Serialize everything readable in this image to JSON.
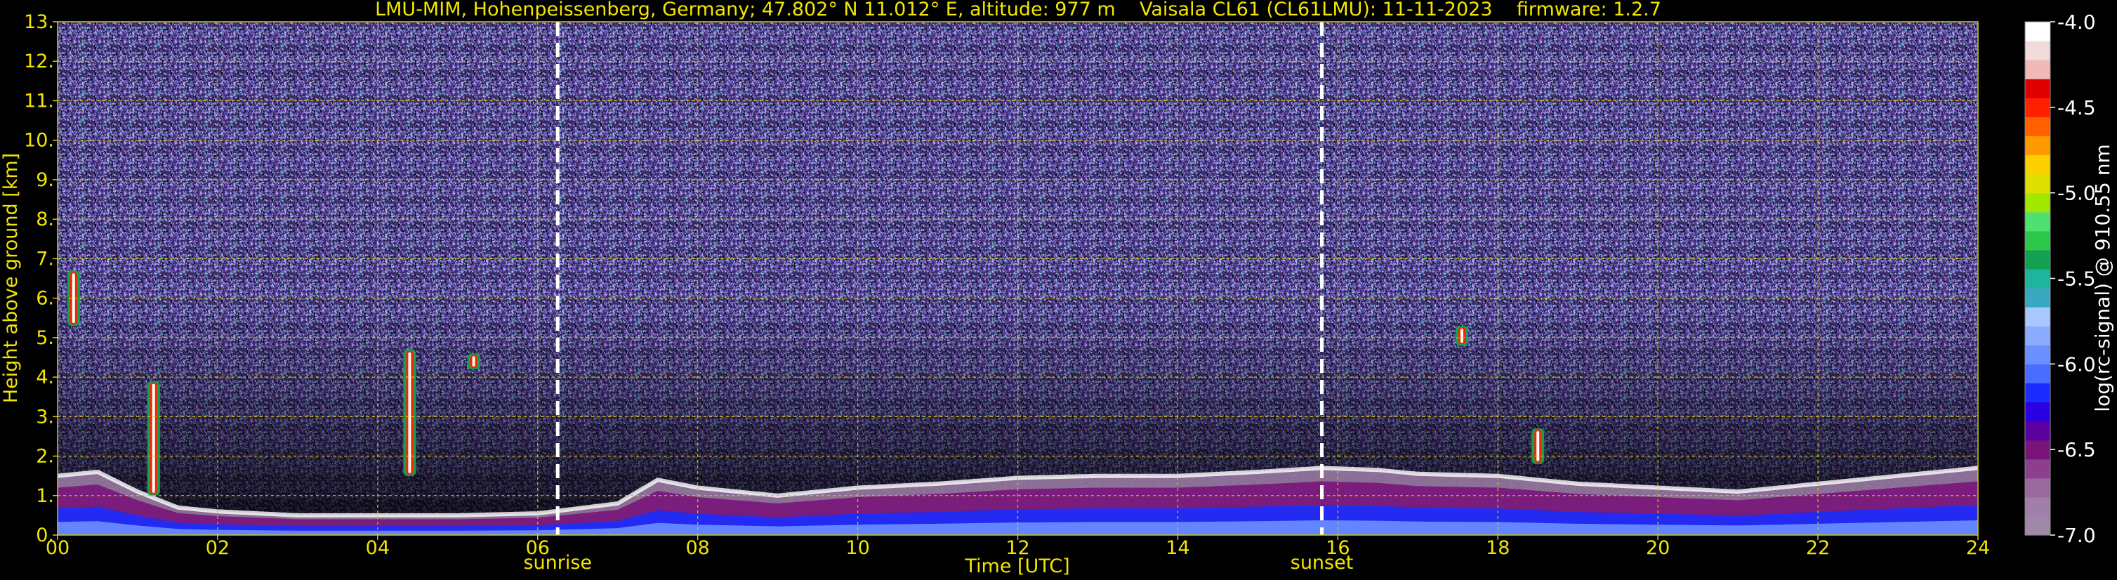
{
  "chart_data": {
    "type": "heatmap",
    "title": "LMU-MIM, Hohenpeissenberg, Germany; 47.802° N 11.012° E, altitude: 977 m    Vaisala CL61 (CL61LMU): 11-11-2023    firmware: 1.2.7",
    "xlabel": "Time [UTC]",
    "ylabel": "Height above ground [km]",
    "colorbar_label": "log(rc-signal) @ 910.55 nm",
    "xlim": [
      0,
      24
    ],
    "ylim": [
      0,
      13
    ],
    "clim": [
      -7.0,
      -4.0
    ],
    "x_ticks": [
      "00",
      "02",
      "04",
      "06",
      "08",
      "10",
      "12",
      "14",
      "16",
      "18",
      "20",
      "22",
      "24"
    ],
    "y_ticks": [
      "0.",
      "1.",
      "2.",
      "3.",
      "4.",
      "5.",
      "6.",
      "7.",
      "8.",
      "9.",
      "10.",
      "11.",
      "12.",
      "13."
    ],
    "colorbar_ticks": [
      "-4.0",
      "-4.5",
      "-5.0",
      "-5.5",
      "-6.0",
      "-6.5",
      "-7.0"
    ],
    "colorbar_tick_values": [
      -4.0,
      -4.5,
      -5.0,
      -5.5,
      -6.0,
      -6.5,
      -7.0
    ],
    "grid": true,
    "markers": [
      {
        "label": "sunrise",
        "x": 6.25
      },
      {
        "label": "sunset",
        "x": 15.8
      }
    ],
    "boundary_layer_top": [
      [
        0,
        1.5
      ],
      [
        0.5,
        1.6
      ],
      [
        1,
        1.1
      ],
      [
        1.5,
        0.7
      ],
      [
        2,
        0.6
      ],
      [
        3,
        0.5
      ],
      [
        4,
        0.5
      ],
      [
        5,
        0.5
      ],
      [
        6,
        0.55
      ],
      [
        7,
        0.8
      ],
      [
        7.5,
        1.4
      ],
      [
        8,
        1.2
      ],
      [
        9,
        1.0
      ],
      [
        10,
        1.2
      ],
      [
        11,
        1.3
      ],
      [
        12,
        1.45
      ],
      [
        13,
        1.5
      ],
      [
        14,
        1.5
      ],
      [
        15,
        1.6
      ],
      [
        15.8,
        1.7
      ],
      [
        16.5,
        1.65
      ],
      [
        17,
        1.55
      ],
      [
        18,
        1.5
      ],
      [
        19,
        1.3
      ],
      [
        20,
        1.2
      ],
      [
        21,
        1.1
      ],
      [
        22,
        1.3
      ],
      [
        23,
        1.5
      ],
      [
        24,
        1.7
      ]
    ],
    "cloud_features": [
      {
        "x": 0.2,
        "y": [
          5.3,
          6.7
        ]
      },
      {
        "x": 1.2,
        "y": [
          1.0,
          3.9
        ]
      },
      {
        "x": 4.4,
        "y": [
          1.5,
          4.7
        ]
      },
      {
        "x": 5.2,
        "y": [
          4.2,
          4.6
        ]
      },
      {
        "x": 17.55,
        "y": [
          4.8,
          5.3
        ]
      },
      {
        "x": 18.5,
        "y": [
          1.8,
          2.7
        ]
      }
    ]
  },
  "colors": {
    "background": "#000000",
    "text": "#f2e600",
    "grid": "#d8c800",
    "marker": "#ffffff",
    "colormap": [
      "#a088a8",
      "#a07fa8",
      "#9a6a9f",
      "#8c3f8c",
      "#78147a",
      "#5a00a0",
      "#2a00e0",
      "#1a2cff",
      "#4a6cff",
      "#6a90ff",
      "#8cacff",
      "#a8c8ff",
      "#3aa8c0",
      "#1fb59c",
      "#13a050",
      "#2ec84a",
      "#50e070",
      "#a0e800",
      "#e0e000",
      "#ffd000",
      "#ff9900",
      "#ff6000",
      "#ff2000",
      "#e00000",
      "#f0b8b8",
      "#f0dada",
      "#ffffff"
    ]
  }
}
